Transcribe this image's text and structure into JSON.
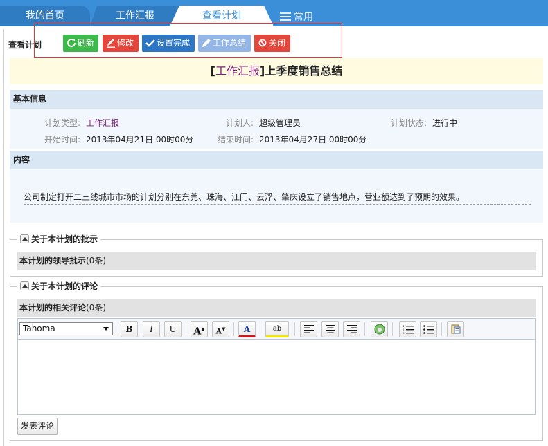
{
  "tabs": [
    {
      "label": "我的首页"
    },
    {
      "label": "工作汇报"
    },
    {
      "label": "查看计划"
    },
    {
      "label": "常用"
    }
  ],
  "toolbar": {
    "title": "查看计划",
    "refresh_label": "刷新",
    "edit_label": "修改",
    "set_done_label": "设置完成",
    "summary_label": "工作总结",
    "close_label": "关闭"
  },
  "plan": {
    "type_bracket_open": "[",
    "type": "工作汇报",
    "type_bracket_close": "]",
    "title": "上季度销售总结"
  },
  "basic_info": {
    "heading": "基本信息",
    "type_label": "计划类型:",
    "type_value": "工作汇报",
    "owner_label": "计划人:",
    "owner_value": "超级管理员",
    "status_label": "计划状态:",
    "status_value": "进行中",
    "start_label": "开始时间:",
    "start_value": "2013年04月21日 00时00分",
    "end_label": "结束时间:",
    "end_value": "2013年04月27日 00时00分"
  },
  "content": {
    "heading": "内容",
    "text": "公司制定打开二三线城市市场的计划分别在东莞、珠海、江门、云浮、肇庆设立了销售地点，营业额达到了预期的效果。"
  },
  "approval": {
    "legend": "关于本计划的批示",
    "bar_label": "本计划的领导批示",
    "count": "(0条)"
  },
  "comments": {
    "legend": "关于本计划的评论",
    "bar_label": "本计划的相关评论",
    "count": "(0条)",
    "font_value": "Tahoma",
    "submit_label": "发表评论"
  },
  "editor_buttons": {
    "bold": "B",
    "italic": "I",
    "underline": "U",
    "grow": "A",
    "shrink": "A",
    "color": "A",
    "highlight": "ab"
  },
  "colors": {
    "tab_bar": "#3a8fd8",
    "refresh": "#3db84a",
    "edit": "#e4463b",
    "done": "#2d76c5",
    "summary": "#94b6e6",
    "close": "#e4463b",
    "plan_type": "#7a1f78",
    "highlight_frame": "#e0393e"
  },
  "icons": {
    "refresh": "refresh-icon",
    "edit": "pencil-icon",
    "done": "check-icon",
    "summary": "pencil-icon",
    "close": "ban-icon",
    "common_menu": "menu-icon",
    "collapse": "collapse-up-icon"
  }
}
